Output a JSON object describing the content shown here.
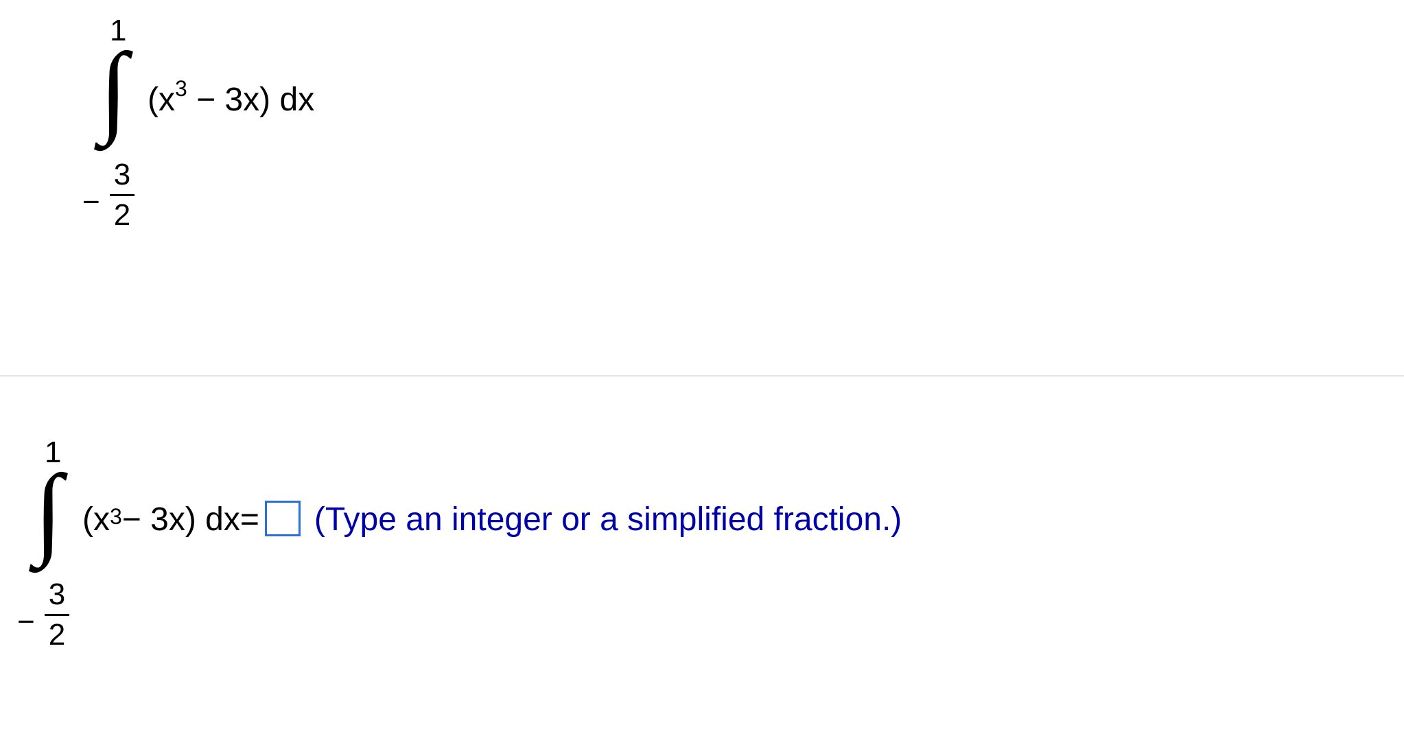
{
  "top_integral": {
    "upper_limit": "1",
    "lower_limit_sign": "−",
    "lower_limit_numer": "3",
    "lower_limit_denom": "2",
    "var_open": "(x",
    "exp": "3",
    "mid": " − 3x) dx"
  },
  "bottom_integral": {
    "upper_limit": "1",
    "lower_limit_sign": "−",
    "lower_limit_numer": "3",
    "lower_limit_denom": "2",
    "var_open": "(x",
    "exp": "3",
    "mid": " − 3x) dx",
    "equals": " = "
  },
  "hint_text": "(Type an integer or a simplified fraction.)"
}
